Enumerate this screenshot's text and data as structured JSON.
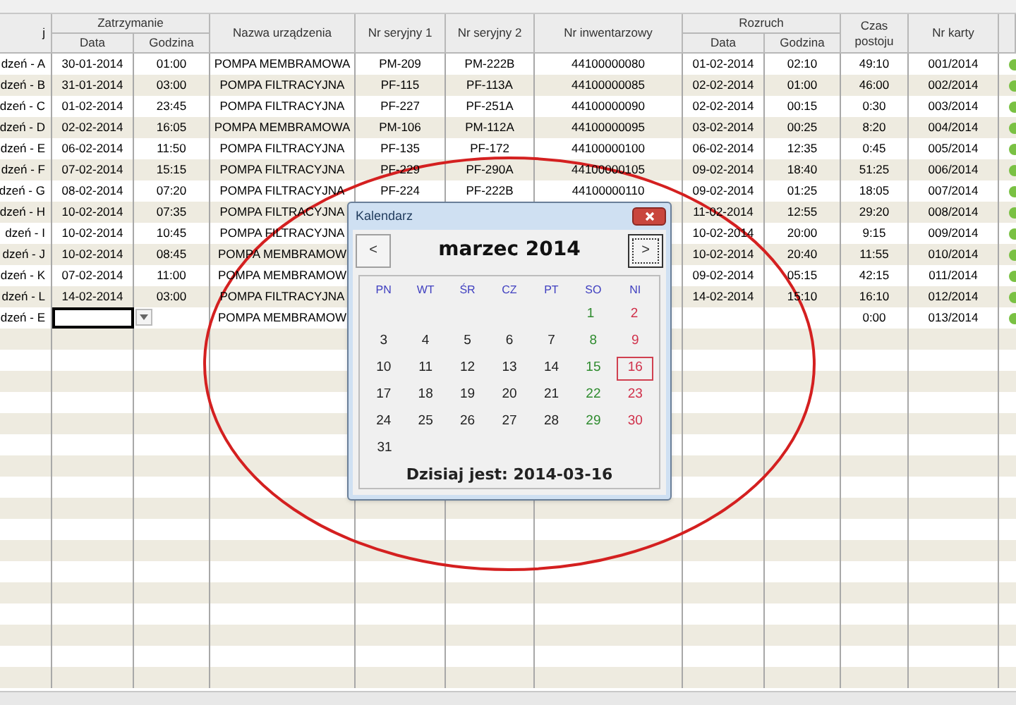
{
  "table": {
    "headers": {
      "first": "j",
      "stop_group": "Zatrzymanie",
      "stop_date": "Data",
      "stop_time": "Godzina",
      "name": "Nazwa urządzenia",
      "serial1": "Nr seryjny 1",
      "serial2": "Nr seryjny 2",
      "inventory": "Nr inwentarzowy",
      "start_group": "Rozruch",
      "start_date": "Data",
      "start_time": "Godzina",
      "downtime": "Czas postoju",
      "card": "Nr karty"
    },
    "rows": [
      {
        "device": "dzeń - A",
        "stop_date": "30-01-2014",
        "stop_time": "01:00",
        "name": "POMPA MEMBRAMOWA",
        "serial1": "PM-209",
        "serial2": "PM-222B",
        "inventory": "44100000080",
        "start_date": "01-02-2014",
        "start_time": "02:10",
        "downtime": "49:10",
        "card": "001/2014",
        "color": "#7ac143",
        "active": false
      },
      {
        "device": "dzeń - B",
        "stop_date": "31-01-2014",
        "stop_time": "03:00",
        "name": "POMPA FILTRACYJNA",
        "serial1": "PF-115",
        "serial2": "PF-113A",
        "inventory": "44100000085",
        "start_date": "02-02-2014",
        "start_time": "01:00",
        "downtime": "46:00",
        "card": "002/2014",
        "color": "#7ac143",
        "active": false
      },
      {
        "device": "dzeń - C",
        "stop_date": "01-02-2014",
        "stop_time": "23:45",
        "name": "POMPA FILTRACYJNA",
        "serial1": "PF-227",
        "serial2": "PF-251A",
        "inventory": "44100000090",
        "start_date": "02-02-2014",
        "start_time": "00:15",
        "downtime": "0:30",
        "card": "003/2014",
        "color": "#7ac143",
        "active": false
      },
      {
        "device": "dzeń - D",
        "stop_date": "02-02-2014",
        "stop_time": "16:05",
        "name": "POMPA MEMBRAMOWA",
        "serial1": "PM-106",
        "serial2": "PM-112A",
        "inventory": "44100000095",
        "start_date": "03-02-2014",
        "start_time": "00:25",
        "downtime": "8:20",
        "card": "004/2014",
        "color": "#7ac143",
        "active": false
      },
      {
        "device": "dzeń - E",
        "stop_date": "06-02-2014",
        "stop_time": "11:50",
        "name": "POMPA FILTRACYJNA",
        "serial1": "PF-135",
        "serial2": "PF-172",
        "inventory": "44100000100",
        "start_date": "06-02-2014",
        "start_time": "12:35",
        "downtime": "0:45",
        "card": "005/2014",
        "color": "#7ac143",
        "active": false
      },
      {
        "device": "dzeń - F",
        "stop_date": "07-02-2014",
        "stop_time": "15:15",
        "name": "POMPA FILTRACYJNA",
        "serial1": "PF-229",
        "serial2": "PF-290A",
        "inventory": "44100000105",
        "start_date": "09-02-2014",
        "start_time": "18:40",
        "downtime": "51:25",
        "card": "006/2014",
        "color": "#7ac143",
        "active": false
      },
      {
        "device": "dzeń - G",
        "stop_date": "08-02-2014",
        "stop_time": "07:20",
        "name": "POMPA FILTRACYJNA",
        "serial1": "PF-224",
        "serial2": "PF-222B",
        "inventory": "44100000110",
        "start_date": "09-02-2014",
        "start_time": "01:25",
        "downtime": "18:05",
        "card": "007/2014",
        "color": "#7ac143",
        "active": false
      },
      {
        "device": "dzeń - H",
        "stop_date": "10-02-2014",
        "stop_time": "07:35",
        "name": "POMPA FILTRACYJNA",
        "start_date": "11-02-2014",
        "start_time": "12:55",
        "downtime": "29:20",
        "card": "008/2014",
        "color": "#7ac143",
        "active": false
      },
      {
        "device": "dzeń - I",
        "stop_date": "10-02-2014",
        "stop_time": "10:45",
        "name": "POMPA FILTRACYJNA",
        "start_date": "10-02-2014",
        "start_time": "20:00",
        "downtime": "9:15",
        "card": "009/2014",
        "color": "#7ac143",
        "active": false
      },
      {
        "device": "dzeń - J",
        "stop_date": "10-02-2014",
        "stop_time": "08:45",
        "name": "POMPA MEMBRAMOW",
        "start_date": "10-02-2014",
        "start_time": "20:40",
        "downtime": "11:55",
        "card": "010/2014",
        "color": "#7ac143",
        "active": false
      },
      {
        "device": "dzeń - K",
        "stop_date": "07-02-2014",
        "stop_time": "11:00",
        "name": "POMPA MEMBRAMOW",
        "start_date": "09-02-2014",
        "start_time": "05:15",
        "downtime": "42:15",
        "card": "011/2014",
        "color": "#7ac143",
        "active": false
      },
      {
        "device": "dzeń - L",
        "stop_date": "14-02-2014",
        "stop_time": "03:00",
        "name": "POMPA FILTRACYJNA",
        "start_date": "14-02-2014",
        "start_time": "15:10",
        "downtime": "16:10",
        "card": "012/2014",
        "color": "#7ac143",
        "active": false
      },
      {
        "device": "dzeń - E",
        "name": "POMPA MEMBRAMOW",
        "downtime": "0:00",
        "card": "013/2014",
        "color": "#7ac143",
        "active": true
      }
    ]
  },
  "calendar": {
    "title": "Kalendarz",
    "prev": "<",
    "next": ">",
    "month": "marzec 2014",
    "weekdays": [
      {
        "label": "PN"
      },
      {
        "label": "WT"
      },
      {
        "label": "ŚR"
      },
      {
        "label": "CZ"
      },
      {
        "label": "PT"
      },
      {
        "label": "SO"
      },
      {
        "label": "NI"
      }
    ],
    "weeks": [
      {
        "days": [
          {
            "label": "1",
            "kind": "saturday",
            "selected": false
          },
          {
            "label": "2",
            "kind": "sunday",
            "selected": false
          }
        ]
      },
      {
        "days": [
          {
            "label": "3",
            "kind": "weekday",
            "selected": false
          },
          {
            "label": "4",
            "kind": "weekday",
            "selected": false
          },
          {
            "label": "5",
            "kind": "weekday",
            "selected": false
          },
          {
            "label": "6",
            "kind": "weekday",
            "selected": false
          },
          {
            "label": "7",
            "kind": "weekday",
            "selected": false
          },
          {
            "label": "8",
            "kind": "saturday",
            "selected": false
          },
          {
            "label": "9",
            "kind": "sunday",
            "selected": false
          }
        ]
      },
      {
        "days": [
          {
            "label": "10",
            "kind": "weekday",
            "selected": false
          },
          {
            "label": "11",
            "kind": "weekday",
            "selected": false
          },
          {
            "label": "12",
            "kind": "weekday",
            "selected": false
          },
          {
            "label": "13",
            "kind": "weekday",
            "selected": false
          },
          {
            "label": "14",
            "kind": "weekday",
            "selected": false
          },
          {
            "label": "15",
            "kind": "saturday",
            "selected": false
          },
          {
            "label": "16",
            "kind": "sunday",
            "selected": true
          }
        ]
      },
      {
        "days": [
          {
            "label": "17",
            "kind": "weekday",
            "selected": false
          },
          {
            "label": "18",
            "kind": "weekday",
            "selected": false
          },
          {
            "label": "19",
            "kind": "weekday",
            "selected": false
          },
          {
            "label": "20",
            "kind": "weekday",
            "selected": false
          },
          {
            "label": "21",
            "kind": "weekday",
            "selected": false
          },
          {
            "label": "22",
            "kind": "saturday",
            "selected": false
          },
          {
            "label": "23",
            "kind": "sunday",
            "selected": false
          }
        ]
      },
      {
        "days": [
          {
            "label": "24",
            "kind": "weekday",
            "selected": false
          },
          {
            "label": "25",
            "kind": "weekday",
            "selected": false
          },
          {
            "label": "26",
            "kind": "weekday",
            "selected": false
          },
          {
            "label": "27",
            "kind": "weekday",
            "selected": false
          },
          {
            "label": "28",
            "kind": "weekday",
            "selected": false
          },
          {
            "label": "29",
            "kind": "saturday",
            "selected": false
          },
          {
            "label": "30",
            "kind": "sunday",
            "selected": false
          }
        ]
      },
      {
        "days": [
          {
            "label": "31",
            "kind": "weekday",
            "selected": false
          }
        ]
      }
    ],
    "today": "Dzisiaj jest: 2014-03-16"
  }
}
